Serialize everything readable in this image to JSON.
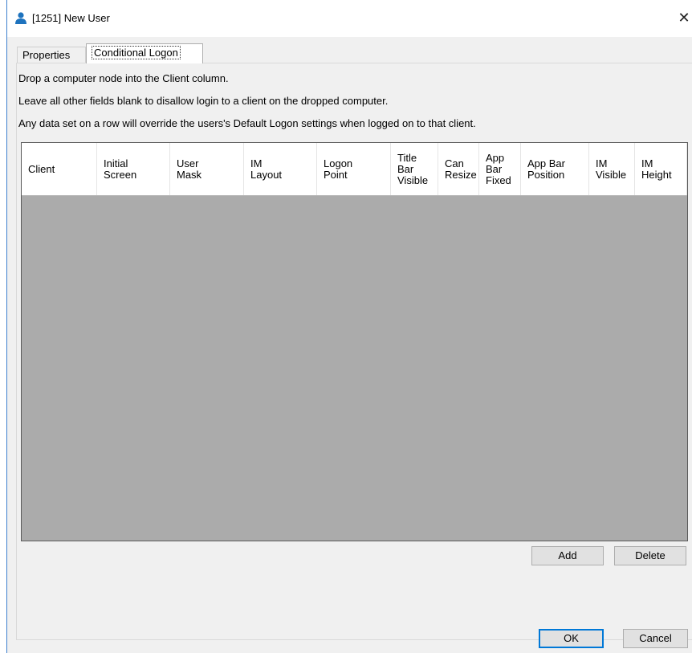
{
  "window": {
    "title": "[1251] New User",
    "close_glyph": "✕",
    "icon": "user-icon"
  },
  "tabs": [
    {
      "label": "Properties",
      "active": false
    },
    {
      "label": "Conditional Logon",
      "active": true
    }
  ],
  "instructions": [
    "Drop a computer node into the Client column.",
    "Leave all other fields blank to disallow login to a client on the dropped computer.",
    "Any data set on a row will override the users's Default Logon settings when logged on to that client."
  ],
  "grid": {
    "columns": [
      "Client",
      "Initial\nScreen",
      "User\nMask",
      "IM\nLayout",
      "Logon\nPoint",
      "Title\nBar\nVisible",
      "Can\nResize",
      "App\nBar\nFixed",
      "App Bar\nPosition",
      "IM\nVisible",
      "IM\nHeight"
    ],
    "rows": []
  },
  "buttons": {
    "add": "Add",
    "delete": "Delete",
    "ok": "OK",
    "cancel": "Cancel"
  },
  "colors": {
    "grid_empty": "#ababab",
    "accent": "#0078d7"
  }
}
